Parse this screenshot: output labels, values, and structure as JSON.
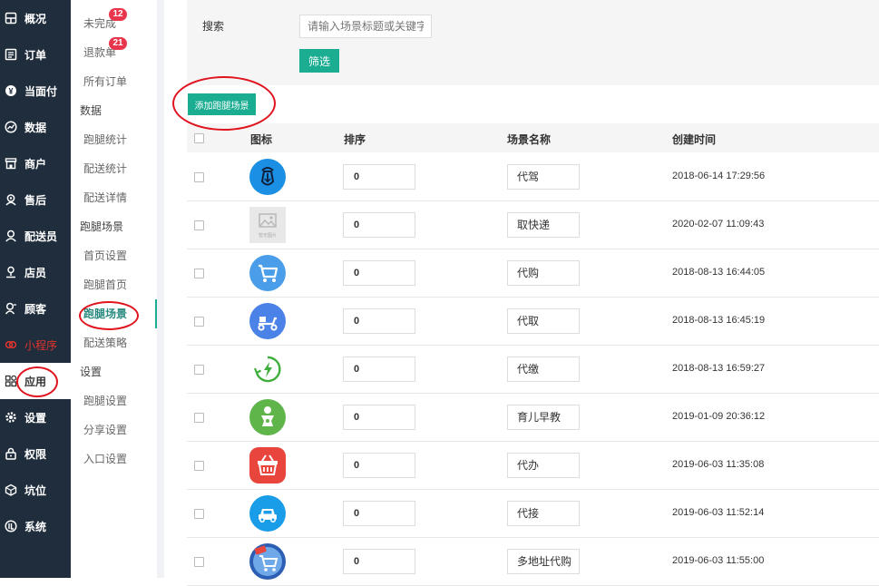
{
  "sidebar": {
    "items": [
      {
        "label": "概况",
        "icon": "overview-icon"
      },
      {
        "label": "订单",
        "icon": "order-icon"
      },
      {
        "label": "当面付",
        "icon": "payment-icon"
      },
      {
        "label": "数据",
        "icon": "data-icon"
      },
      {
        "label": "商户",
        "icon": "store-icon"
      },
      {
        "label": "售后",
        "icon": "aftersale-icon"
      },
      {
        "label": "配送员",
        "icon": "courier-icon"
      },
      {
        "label": "店员",
        "icon": "clerk-icon"
      },
      {
        "label": "顾客",
        "icon": "customer-icon"
      },
      {
        "label": "小程序",
        "icon": "miniprogram-icon"
      },
      {
        "label": "应用",
        "icon": "apps-icon"
      },
      {
        "label": "设置",
        "icon": "settings-icon"
      },
      {
        "label": "权限",
        "icon": "lock-icon"
      },
      {
        "label": "坑位",
        "icon": "cube-icon"
      },
      {
        "label": "系统",
        "icon": "system-icon"
      }
    ],
    "active_color": "#ffffff",
    "bg_color": "#1f2d3d",
    "highlight_color": "#e1342d"
  },
  "subnav": {
    "items": [
      {
        "label": "未完成",
        "badge": "12"
      },
      {
        "label": "退款单",
        "badge": "21"
      },
      {
        "label": "所有订单"
      },
      {
        "label": "数据"
      },
      {
        "label": "跑腿统计"
      },
      {
        "label": "配送统计"
      },
      {
        "label": "配送详情"
      },
      {
        "label": "跑腿场景"
      },
      {
        "label": "首页设置"
      },
      {
        "label": "跑腿首页"
      },
      {
        "label": "跑腿场景"
      },
      {
        "label": "配送策略"
      },
      {
        "label": "设置"
      },
      {
        "label": "跑腿设置"
      },
      {
        "label": "分享设置"
      },
      {
        "label": "入口设置"
      }
    ]
  },
  "filter": {
    "search_label": "搜索",
    "search_placeholder": "请输入场景标题或关键字",
    "filter_button": "筛选"
  },
  "add_button": "添加跑腿场景",
  "accent_color": "#1aad91",
  "table": {
    "headers": {
      "icon": "图标",
      "sort": "排序",
      "name": "场景名称",
      "created": "创建时间"
    },
    "rows": [
      {
        "icon": "designated-driver-icon",
        "sort": "0",
        "name": "代驾",
        "created": "2018-06-14 17:29:56"
      },
      {
        "icon": "placeholder-image-icon",
        "sort": "0",
        "name": "取快递",
        "created": "2020-02-07 11:09:43"
      },
      {
        "icon": "shopping-cart-icon",
        "sort": "0",
        "name": "代购",
        "created": "2018-08-13 16:44:05"
      },
      {
        "icon": "scooter-icon",
        "sort": "0",
        "name": "代取",
        "created": "2018-08-13 16:45:19"
      },
      {
        "icon": "recycle-bolt-icon",
        "sort": "0",
        "name": "代缴",
        "created": "2018-08-13 16:59:27"
      },
      {
        "icon": "baby-icon",
        "sort": "0",
        "name": "育儿早教",
        "created": "2019-01-09 20:36:12"
      },
      {
        "icon": "basket-icon",
        "sort": "0",
        "name": "代办",
        "created": "2019-06-03 11:35:08"
      },
      {
        "icon": "car-icon",
        "sort": "0",
        "name": "代接",
        "created": "2019-06-03 11:52:14"
      },
      {
        "icon": "multi-address-cart-icon",
        "sort": "0",
        "name": "多地址代购",
        "created": "2019-06-03 11:55:00"
      }
    ]
  },
  "placeholder_image_text": "暂无图片",
  "annotation_color": "#e0141e"
}
